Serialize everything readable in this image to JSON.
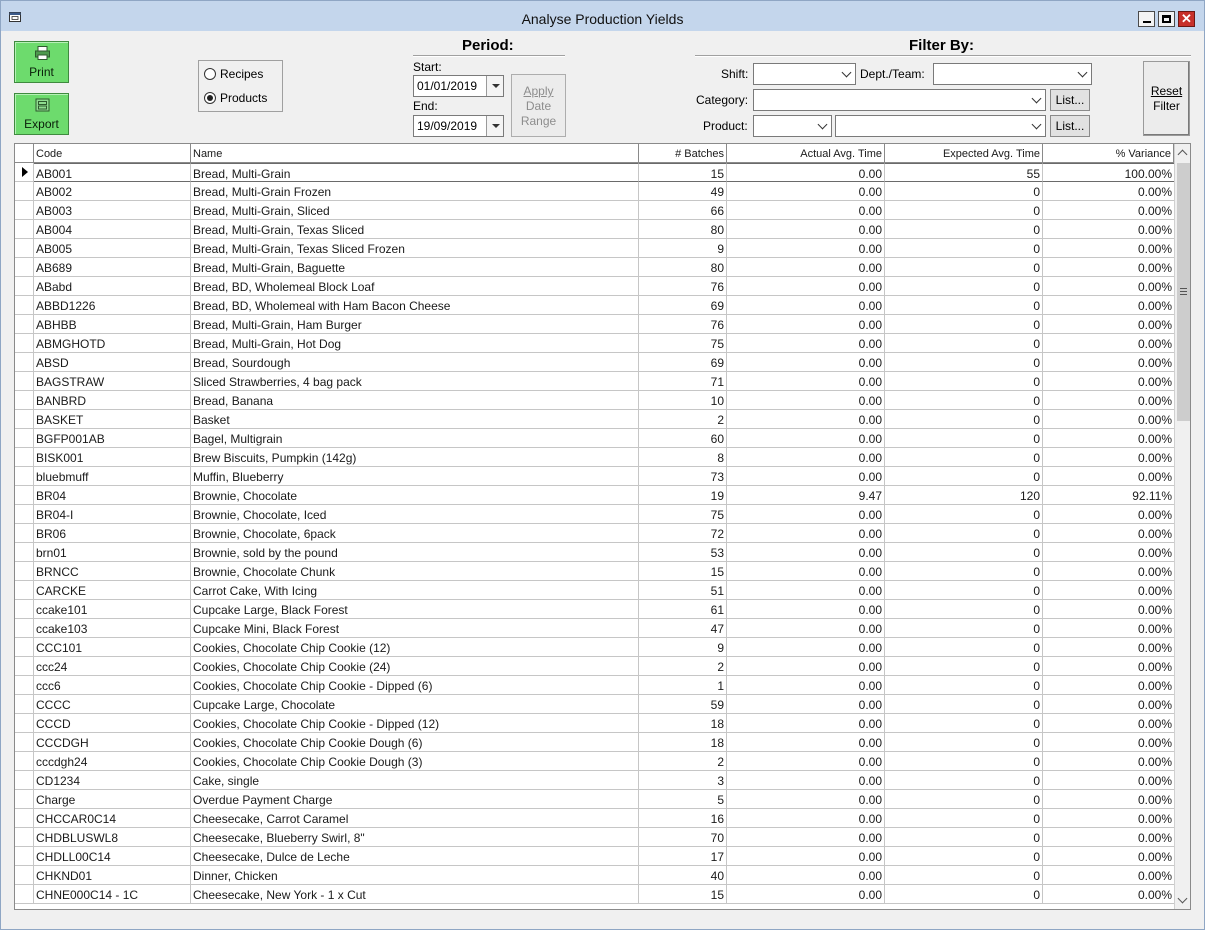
{
  "window": {
    "title": "Analyse Production Yields",
    "close_glyph": "✕"
  },
  "buttons": {
    "print": "Print",
    "export": "Export",
    "apply": [
      "Apply",
      "Date",
      "Range"
    ],
    "reset": [
      "Reset",
      "Filter"
    ],
    "list": "List..."
  },
  "view_mode": {
    "options": [
      "Recipes",
      "Products"
    ],
    "selected": "Products"
  },
  "period": {
    "title": "Period:",
    "start_label": "Start:",
    "start_value": "01/01/2019",
    "end_label": "End:",
    "end_value": "19/09/2019"
  },
  "filter": {
    "title": "Filter By:",
    "shift_label": "Shift:",
    "shift_value": "",
    "dept_label": "Dept./Team:",
    "dept_value": "",
    "category_label": "Category:",
    "category_value": "",
    "product_label": "Product:",
    "product_value": "",
    "product_detail_value": ""
  },
  "grid": {
    "columns": [
      "Code",
      "Name",
      "# Batches",
      "Actual Avg. Time",
      "Expected Avg. Time",
      "% Variance"
    ],
    "rows": [
      [
        "AB001",
        "Bread, Multi-Grain",
        "15",
        "0.00",
        "55",
        "100.00%"
      ],
      [
        "AB002",
        "Bread, Multi-Grain Frozen",
        "49",
        "0.00",
        "0",
        "0.00%"
      ],
      [
        "AB003",
        "Bread, Multi-Grain, Sliced",
        "66",
        "0.00",
        "0",
        "0.00%"
      ],
      [
        "AB004",
        "Bread, Multi-Grain, Texas Sliced",
        "80",
        "0.00",
        "0",
        "0.00%"
      ],
      [
        "AB005",
        "Bread, Multi-Grain, Texas Sliced Frozen",
        "9",
        "0.00",
        "0",
        "0.00%"
      ],
      [
        "AB689",
        "Bread, Multi-Grain, Baguette",
        "80",
        "0.00",
        "0",
        "0.00%"
      ],
      [
        "ABabd",
        "Bread, BD, Wholemeal Block Loaf",
        "76",
        "0.00",
        "0",
        "0.00%"
      ],
      [
        "ABBD1226",
        "Bread, BD, Wholemeal with Ham Bacon Cheese",
        "69",
        "0.00",
        "0",
        "0.00%"
      ],
      [
        "ABHBB",
        "Bread, Multi-Grain, Ham Burger",
        "76",
        "0.00",
        "0",
        "0.00%"
      ],
      [
        "ABMGHOTD",
        "Bread, Multi-Grain, Hot Dog",
        "75",
        "0.00",
        "0",
        "0.00%"
      ],
      [
        "ABSD",
        "Bread, Sourdough",
        "69",
        "0.00",
        "0",
        "0.00%"
      ],
      [
        "BAGSTRAW",
        "Sliced Strawberries, 4 bag pack",
        "71",
        "0.00",
        "0",
        "0.00%"
      ],
      [
        "BANBRD",
        "Bread, Banana",
        "10",
        "0.00",
        "0",
        "0.00%"
      ],
      [
        "BASKET",
        "Basket",
        "2",
        "0.00",
        "0",
        "0.00%"
      ],
      [
        "BGFP001AB",
        "Bagel, Multigrain",
        "60",
        "0.00",
        "0",
        "0.00%"
      ],
      [
        "BISK001",
        "Brew Biscuits, Pumpkin (142g)",
        "8",
        "0.00",
        "0",
        "0.00%"
      ],
      [
        "bluebmuff",
        "Muffin, Blueberry",
        "73",
        "0.00",
        "0",
        "0.00%"
      ],
      [
        "BR04",
        "Brownie, Chocolate",
        "19",
        "9.47",
        "120",
        "92.11%"
      ],
      [
        "BR04-I",
        "Brownie, Chocolate, Iced",
        "75",
        "0.00",
        "0",
        "0.00%"
      ],
      [
        "BR06",
        "Brownie, Chocolate, 6pack",
        "72",
        "0.00",
        "0",
        "0.00%"
      ],
      [
        "brn01",
        "Brownie, sold by the pound",
        "53",
        "0.00",
        "0",
        "0.00%"
      ],
      [
        "BRNCC",
        "Brownie, Chocolate Chunk",
        "15",
        "0.00",
        "0",
        "0.00%"
      ],
      [
        "CARCKE",
        "Carrot Cake, With Icing",
        "51",
        "0.00",
        "0",
        "0.00%"
      ],
      [
        "ccake101",
        "Cupcake Large, Black Forest",
        "61",
        "0.00",
        "0",
        "0.00%"
      ],
      [
        "ccake103",
        "Cupcake Mini, Black Forest",
        "47",
        "0.00",
        "0",
        "0.00%"
      ],
      [
        "CCC101",
        "Cookies, Chocolate Chip Cookie (12)",
        "9",
        "0.00",
        "0",
        "0.00%"
      ],
      [
        "ccc24",
        "Cookies, Chocolate Chip Cookie (24)",
        "2",
        "0.00",
        "0",
        "0.00%"
      ],
      [
        "ccc6",
        "Cookies, Chocolate Chip Cookie - Dipped (6)",
        "1",
        "0.00",
        "0",
        "0.00%"
      ],
      [
        "CCCC",
        "Cupcake Large, Chocolate",
        "59",
        "0.00",
        "0",
        "0.00%"
      ],
      [
        "CCCD",
        "Cookies, Chocolate Chip Cookie - Dipped (12)",
        "18",
        "0.00",
        "0",
        "0.00%"
      ],
      [
        "CCCDGH",
        "Cookies, Chocolate Chip Cookie Dough (6)",
        "18",
        "0.00",
        "0",
        "0.00%"
      ],
      [
        "cccdgh24",
        "Cookies, Chocolate Chip Cookie Dough (3)",
        "2",
        "0.00",
        "0",
        "0.00%"
      ],
      [
        "CD1234",
        "Cake, single",
        "3",
        "0.00",
        "0",
        "0.00%"
      ],
      [
        "Charge",
        "Overdue Payment Charge",
        "5",
        "0.00",
        "0",
        "0.00%"
      ],
      [
        "CHCCAR0C14",
        "Cheesecake, Carrot Caramel",
        "16",
        "0.00",
        "0",
        "0.00%"
      ],
      [
        "CHDBLUSWL8",
        "Cheesecake, Blueberry Swirl, 8\"",
        "70",
        "0.00",
        "0",
        "0.00%"
      ],
      [
        "CHDLL00C14",
        "Cheesecake, Dulce de Leche",
        "17",
        "0.00",
        "0",
        "0.00%"
      ],
      [
        "CHKND01",
        "Dinner, Chicken",
        "40",
        "0.00",
        "0",
        "0.00%"
      ],
      [
        "CHNE000C14 - 1C",
        "Cheesecake, New York - 1 x Cut",
        "15",
        "0.00",
        "0",
        "0.00%"
      ]
    ]
  }
}
